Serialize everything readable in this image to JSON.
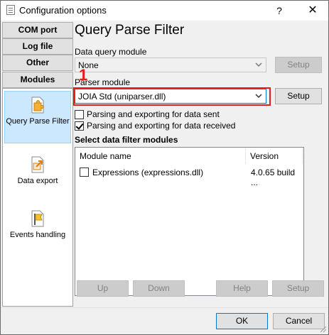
{
  "window": {
    "title": "Configuration options",
    "help": "?",
    "close": "✕"
  },
  "sidebar": {
    "tabs": [
      "COM port",
      "Log file",
      "Other",
      "Modules"
    ],
    "modules": [
      {
        "label": "Query Parse Filter",
        "icon": "puzzle-icon"
      },
      {
        "label": "Data export",
        "icon": "export-icon"
      },
      {
        "label": "Events handling",
        "icon": "flag-icon"
      }
    ]
  },
  "main": {
    "title": "Query Parse Filter",
    "data_query_label": "Data query module",
    "data_query_value": "None",
    "parser_label": "Parser module",
    "parser_value": "JOIA Std (uniparser.dll)",
    "setup": "Setup",
    "chk_sent": "Parsing and exporting for data sent",
    "chk_received": "Parsing and exporting for data received",
    "filter_title": "Select data filter modules",
    "table": {
      "headers": [
        "Module name",
        "Version"
      ],
      "rows": [
        {
          "name": "Expressions (expressions.dll)",
          "version": "4.0.65 build ..."
        }
      ]
    },
    "buttons": {
      "up": "Up",
      "down": "Down",
      "help": "Help",
      "setup": "Setup"
    }
  },
  "footer": {
    "ok": "OK",
    "cancel": "Cancel"
  },
  "annotation": {
    "number": "1",
    "color": "#e02020"
  }
}
